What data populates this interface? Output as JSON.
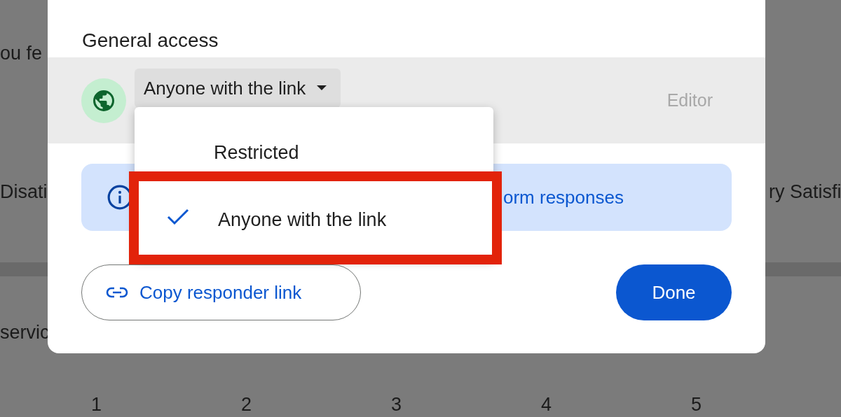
{
  "background": {
    "question_text": "ou fe",
    "left_label": "Disati",
    "right_label": "ry Satisfi",
    "second_question": "servic",
    "scale": [
      "1",
      "2",
      "3",
      "4",
      "5"
    ]
  },
  "dialog": {
    "section_title": "General access",
    "access_dropdown": {
      "value": "Anyone with the link",
      "expanded": true
    },
    "role": {
      "label": "Editor",
      "disabled": true
    },
    "info_banner": "orm responses",
    "menu": [
      {
        "label": "Restricted",
        "selected": false,
        "highlighted": false
      },
      {
        "label": "Anyone with the link",
        "selected": true,
        "highlighted": true
      }
    ],
    "copy_link_button": "Copy responder link",
    "done_button": "Done"
  }
}
